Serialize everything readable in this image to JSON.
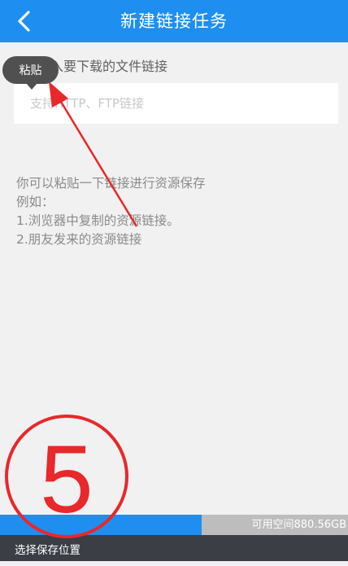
{
  "header": {
    "title": "新建链接任务",
    "back_icon": "chevron-left-icon",
    "color": "#1e8ff0"
  },
  "form": {
    "label": "输入要下载的文件链接",
    "placeholder": "支持HTTP、FTP链接",
    "value": ""
  },
  "hint": {
    "line1": "你可以粘贴一下链接进行资源保存",
    "line2": "例如：",
    "line3": "1.浏览器中复制的资源链接。",
    "line4": "2.朋友发来的资源链接"
  },
  "paste_tooltip": {
    "label": "粘贴"
  },
  "annotation": {
    "step_number": "5",
    "color": "#e8282b"
  },
  "storage": {
    "text": "可用空间880.56GB",
    "used_fraction": 0.58,
    "fill_color": "#1e8ff0"
  },
  "footer": {
    "save_location_label": "选择保存位置"
  }
}
